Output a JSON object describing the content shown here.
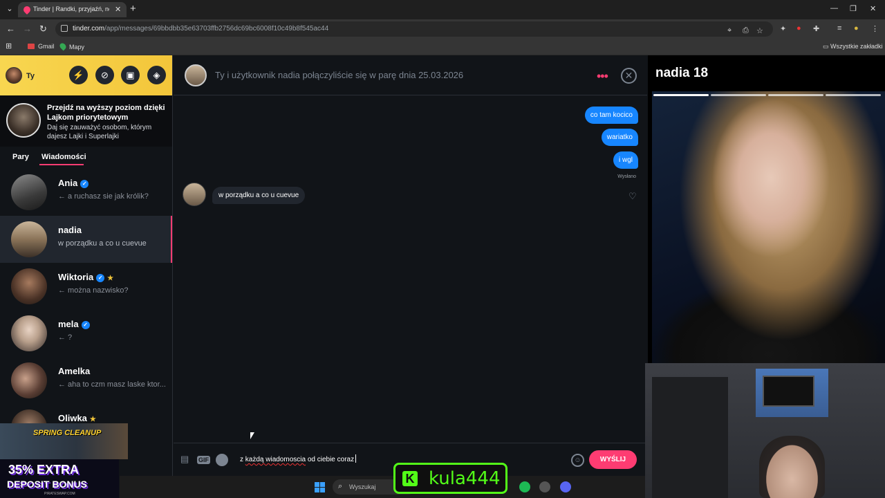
{
  "browser": {
    "tab_title": "Tinder | Randki, przyjaźń, nowe",
    "url_host": "tinder.com",
    "url_path": "/app/messages/69bbdbb35e63703ffb2756dc69bc6008f10c49b8f545ac44",
    "bookmarks": [
      "Gmail",
      "Mapy"
    ],
    "all_bookmarks": "Wszystkie zakładki"
  },
  "sidebar": {
    "me_label": "Ty",
    "promo_title": "Przejdź na wyższy poziom dzięki Lajkom priorytetowym",
    "promo_sub": "Daj się zauważyć osobom, którym dajesz Lajki i Superlajki",
    "tabs": [
      "Pary",
      "Wiadomości"
    ],
    "conversations": [
      {
        "name": "Ania",
        "message": "← a ruchasz sie jak królik?"
      },
      {
        "name": "nadia",
        "message": "w porządku a co u cuevue"
      },
      {
        "name": "Wiktoria",
        "message": "← można nazwisko?"
      },
      {
        "name": "mela",
        "message": "← ?"
      },
      {
        "name": "Amelka",
        "message": "← aha to czm masz laske ktor..."
      },
      {
        "name": "Oliwka",
        "message": ""
      }
    ]
  },
  "chat": {
    "header": "Ty i użytkownik nadia połączyliście się w parę dnia 25.03.2026",
    "outgoing": [
      "co tam kocico",
      "wariatko",
      "i wgl"
    ],
    "sent_label": "Wysłano",
    "incoming": "w porządku a co u cuevue",
    "gif_label": "GIF",
    "input_misspelled": "każdą wiadomoscia",
    "input_value": "z każdą wiadomoscia od ciebie coraz",
    "send_label": "WYŚLIJ"
  },
  "profile": {
    "name": "nadia",
    "age": "18"
  },
  "overlay": {
    "ad_banner": "SPRING CLEANUP",
    "ad_pct": "35% EXTRA",
    "ad_deposit": "DEPOSIT BONUS",
    "ad_site": "PIRATESWAP.COM",
    "kick_name": "kula444",
    "taskbar_search": "Wyszukaj"
  },
  "colors": {
    "tinder_pink": "#fe3c72",
    "message_blue": "#1786ff",
    "gold": "#f3c63a",
    "kick_green": "#53fc18"
  }
}
